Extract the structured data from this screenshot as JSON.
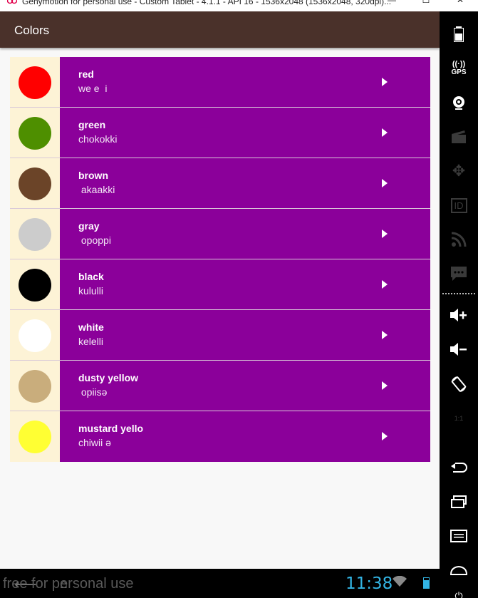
{
  "window": {
    "title": "Genymotion for personal use - Custom Tablet - 4.1.1 - API 16 - 1536x2048 (1536x2048, 320dpi)...",
    "minimize_label": "—",
    "maximize_label": "☐",
    "close_label": "✕"
  },
  "app": {
    "title": "Colors",
    "colors": [
      {
        "english": "red",
        "translation": "we e  i",
        "swatch": "#ff0000"
      },
      {
        "english": "green",
        "translation": "chokokki",
        "swatch": "#4e8f00"
      },
      {
        "english": "brown",
        "translation": " akaakki",
        "swatch": "#6b4428"
      },
      {
        "english": "gray",
        "translation": " opoppi",
        "swatch": "#cccccc"
      },
      {
        "english": "black",
        "translation": "kululli",
        "swatch": "#000000"
      },
      {
        "english": "white",
        "translation": "kelelli",
        "swatch": "#ffffff"
      },
      {
        "english": "dusty yellow",
        "translation": " opiisə",
        "swatch": "#c9ad7c"
      },
      {
        "english": "mustard yello",
        "translation": "chiwii ə",
        "swatch": "#ffff33"
      }
    ],
    "play_icon": "play-icon"
  },
  "sidebar": {
    "gps_label": "GPS",
    "id_label": "ID",
    "scale_label": "1:1"
  },
  "statusbar": {
    "watermark": "free for personal use",
    "time": "11:38"
  },
  "theme": {
    "actionbar": "#4a312a",
    "row_background": "#8b009a",
    "swatch_background": "#fdf3d6",
    "clock": "#33b5e5"
  }
}
